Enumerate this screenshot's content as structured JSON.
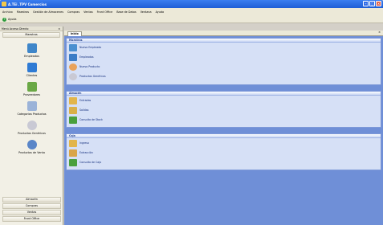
{
  "window": {
    "title": "A.TEi .TPV Comercios"
  },
  "menubar": {
    "items": [
      "Archivo",
      "Maestros",
      "Gestión de Almacenes",
      "Compras",
      "Ventas",
      "Front Office",
      "Base de Datos",
      "Ventana",
      "Ayuda"
    ]
  },
  "toolbar": {
    "help_label": "Ayuda"
  },
  "left_panel": {
    "header": "Menú Acceso Directo",
    "pin_glyph": "×",
    "section_title": "Maestros",
    "items": [
      {
        "label": "Empleados",
        "icon": "employees-icon",
        "color": "#3f86c9"
      },
      {
        "label": "Clientes",
        "icon": "customers-icon",
        "color": "#2f7bd4"
      },
      {
        "label": "Proveedores",
        "icon": "suppliers-icon",
        "color": "#6aa845"
      },
      {
        "label": "Categorias Productos",
        "icon": "categories-icon",
        "color": "#9bb3d8"
      },
      {
        "label": "Productos Genéricos",
        "icon": "generic-products-icon",
        "color": "#c9c9d4"
      },
      {
        "label": "Productos de Venta",
        "icon": "sale-products-icon",
        "color": "#5a86c8"
      }
    ],
    "bottom_sections": [
      "Almacén",
      "Compras",
      "Ventas",
      "Front Office"
    ]
  },
  "tabs": {
    "active_label": "Inicio",
    "close_glyph": "×"
  },
  "groups": [
    {
      "title": "Maestros",
      "items": [
        {
          "label": "Nuevo Empleado",
          "icon": "new-employee-icon",
          "color": "#4a8fd0"
        },
        {
          "label": "Empleados",
          "icon": "employees-list-icon",
          "color": "#3a7cc6"
        },
        {
          "label": "Nuevo Producto",
          "icon": "new-product-icon",
          "color": "#e8a25a"
        },
        {
          "label": "Productos Genéricos",
          "icon": "generic-products-list-icon",
          "color": "#c9c9d4"
        }
      ]
    },
    {
      "title": "Almacén",
      "items": [
        {
          "label": "Entradas",
          "icon": "entries-icon",
          "color": "#e2b54a"
        },
        {
          "label": "Salidas",
          "icon": "exits-icon",
          "color": "#d9b048"
        },
        {
          "label": "Consulta de Stock",
          "icon": "stock-query-icon",
          "color": "#4aa03c"
        }
      ]
    },
    {
      "title": "Caja",
      "items": [
        {
          "label": "Ingreso",
          "icon": "income-icon",
          "color": "#e2b54a"
        },
        {
          "label": "Extracción",
          "icon": "withdrawal-icon",
          "color": "#d9a548"
        },
        {
          "label": "Consulta de Caja",
          "icon": "cash-query-icon",
          "color": "#4aa03c"
        }
      ]
    }
  ]
}
